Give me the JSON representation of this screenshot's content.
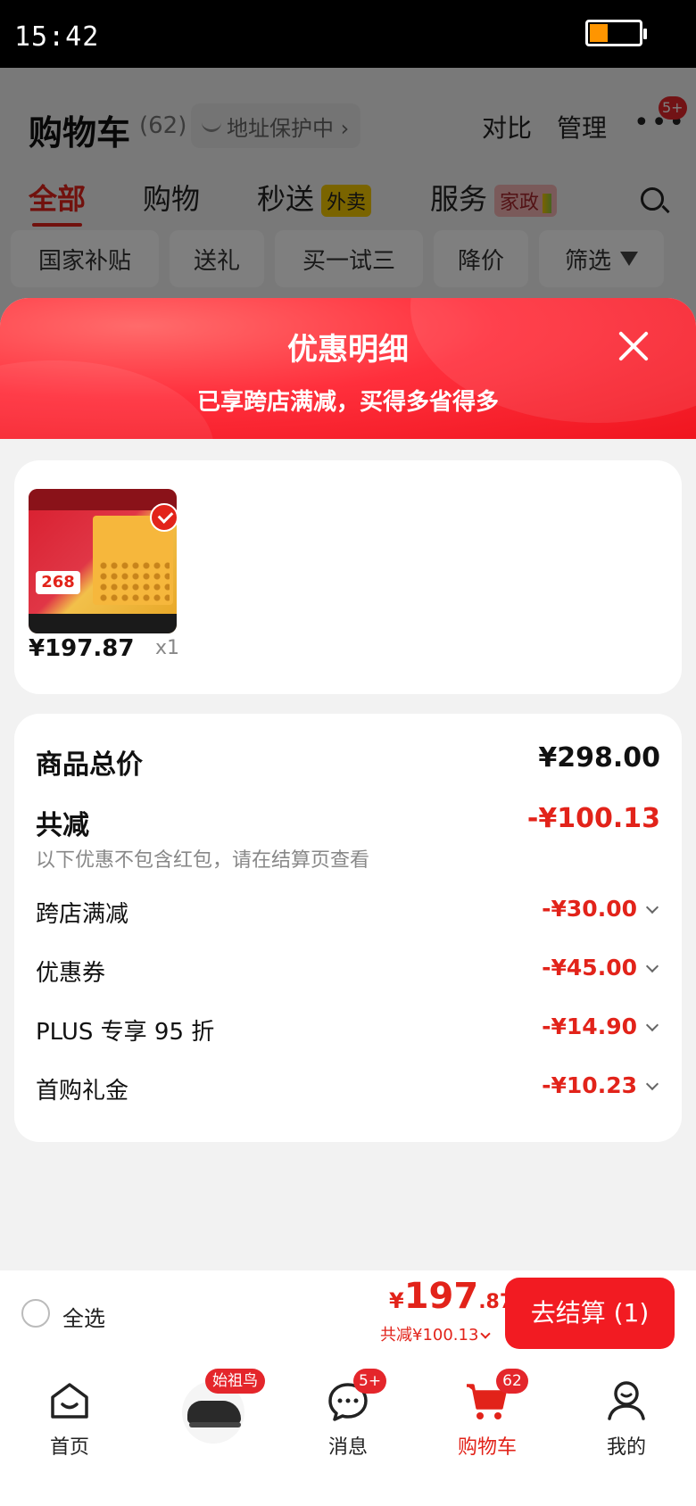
{
  "status_bar": {
    "time": "15:42"
  },
  "cart_page": {
    "title": "购物车",
    "count": "(62)",
    "address_chip": "地址保护中 ›",
    "compare": "对比",
    "manage": "管理",
    "more_badge": "5+",
    "tabs": [
      {
        "label": "全部"
      },
      {
        "label": "购物"
      },
      {
        "label": "秒送",
        "tag": "外卖"
      },
      {
        "label": "服务",
        "tag": "家政"
      }
    ],
    "filters": [
      "国家补贴",
      "送礼",
      "买一试三",
      "降价",
      "筛选"
    ]
  },
  "sheet": {
    "title": "优惠明细",
    "subtitle": "已享跨店满减，买得多省得多",
    "product": {
      "price": "¥197.87",
      "qty": "x1",
      "image_price_tag": "268"
    },
    "summary": {
      "total_label": "商品总价",
      "total_value": "¥298.00",
      "reduce_label": "共减",
      "reduce_value": "-¥100.13",
      "note": "以下优惠不包含红包，请在结算页查看",
      "items": [
        {
          "label": "跨店满减",
          "value": "-¥30.00"
        },
        {
          "label": "优惠券",
          "value": "-¥45.00"
        },
        {
          "label": "PLUS 专享 95 折",
          "value": "-¥14.90"
        },
        {
          "label": "首购礼金",
          "value": "-¥10.23"
        }
      ]
    }
  },
  "checkout_bar": {
    "select_all": "全选",
    "currency": "¥",
    "total_int": "197",
    "total_dec": ".87",
    "total_save": "共减¥100.13",
    "button": "去结算 (1)"
  },
  "tab_bar": {
    "items": [
      {
        "label": "首页",
        "icon": "home-icon"
      },
      {
        "label": "",
        "icon": "shoe-promo-icon",
        "tag": "始祖鸟"
      },
      {
        "label": "消息",
        "icon": "message-icon",
        "badge": "5+"
      },
      {
        "label": "购物车",
        "icon": "cart-icon",
        "badge": "62"
      },
      {
        "label": "我的",
        "icon": "profile-icon"
      }
    ]
  },
  "colors": {
    "accent": "#e2231a",
    "checkout_button": "#f21b22",
    "sheet_header": "#ff2f3c"
  }
}
